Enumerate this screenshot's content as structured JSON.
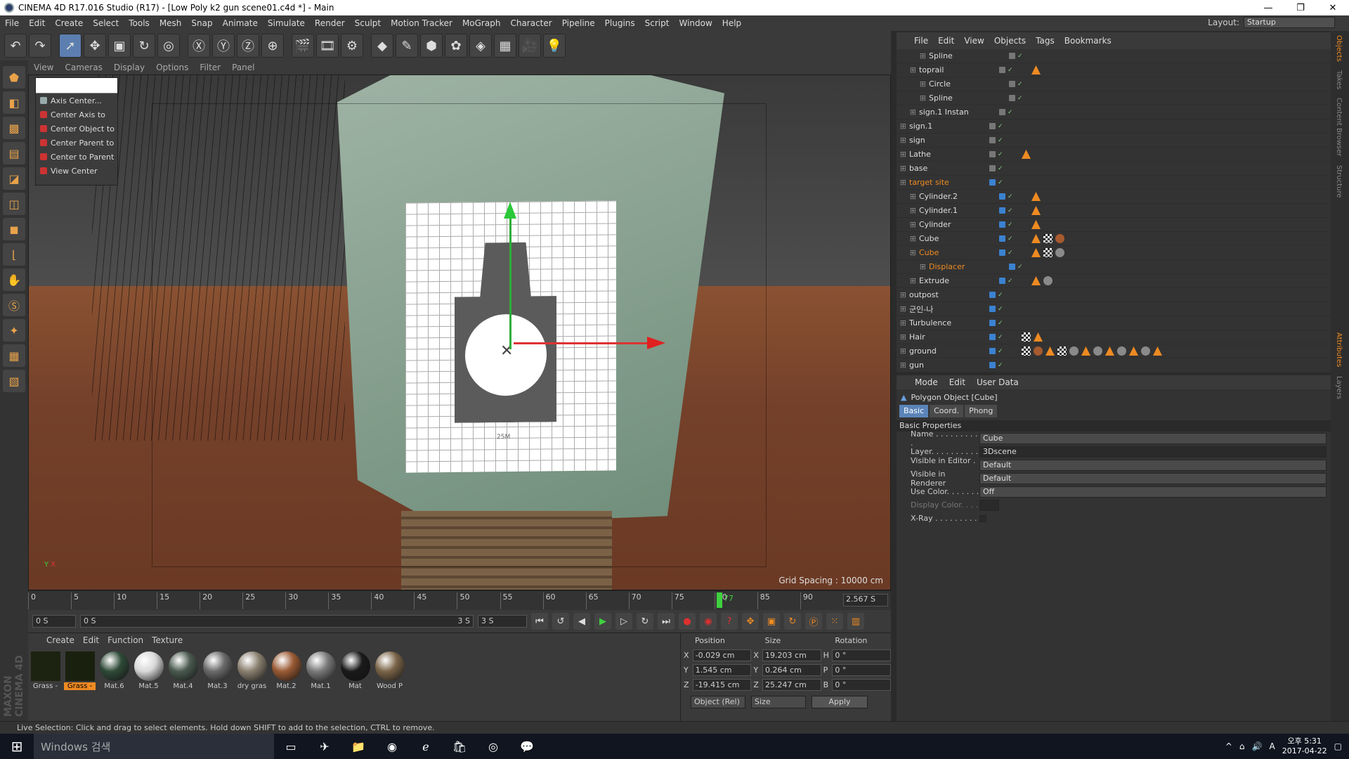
{
  "window": {
    "title": "CINEMA 4D R17.016 Studio (R17) - [Low Poly k2 gun scene01.c4d *] - Main"
  },
  "menubar": {
    "items": [
      "File",
      "Edit",
      "Create",
      "Select",
      "Tools",
      "Mesh",
      "Snap",
      "Animate",
      "Simulate",
      "Render",
      "Sculpt",
      "Motion Tracker",
      "MoGraph",
      "Character",
      "Pipeline",
      "Plugins",
      "Script",
      "Window",
      "Help"
    ],
    "layout_label": "Layout:",
    "layout_value": "Startup"
  },
  "viewport": {
    "menu": [
      "View",
      "Cameras",
      "Display",
      "Options",
      "Filter",
      "Panel"
    ],
    "grid_spacing": "Grid Spacing : 10000 cm",
    "target_label": "25M",
    "axis_y": "Y",
    "axis_x": "X"
  },
  "context_menu": {
    "items": [
      "Axis Center...",
      "Center Axis to",
      "Center Object to",
      "Center Parent to",
      "Center to Parent",
      "View Center"
    ]
  },
  "timeline": {
    "ticks": [
      "0",
      "5",
      "10",
      "15",
      "20",
      "25",
      "30",
      "35",
      "40",
      "45",
      "50",
      "55",
      "60",
      "65",
      "70",
      "75",
      "80",
      "85",
      "90"
    ],
    "current_frame": "77",
    "end_time": "2.567 S"
  },
  "playbar": {
    "start": "0 S",
    "range_start": "0 S",
    "range_end": "3 S",
    "end": "3 S"
  },
  "materials": {
    "menu": [
      "Create",
      "Edit",
      "Function",
      "Texture"
    ],
    "items": [
      {
        "label": "Grass -",
        "swatch": "#1c2310"
      },
      {
        "label": "Grass -",
        "swatch": "#1a200e",
        "selected": true
      },
      {
        "label": "Mat.6",
        "swatch": "#2f4a38"
      },
      {
        "label": "Mat.5",
        "swatch": "#d8d8d8"
      },
      {
        "label": "Mat.4",
        "swatch": "#4a5a50"
      },
      {
        "label": "Mat.3",
        "swatch": "#6a6a6a"
      },
      {
        "label": "dry gras",
        "swatch": "#8a8070"
      },
      {
        "label": "Mat.2",
        "swatch": "#9a5a34"
      },
      {
        "label": "Mat.1",
        "swatch": "#7a7a7a"
      },
      {
        "label": "Mat",
        "swatch": "#1a1a1a"
      },
      {
        "label": "Wood P",
        "swatch": "#7a6448"
      }
    ]
  },
  "coordinates": {
    "headers": [
      "Position",
      "Size",
      "Rotation"
    ],
    "rows": [
      {
        "axis": "X",
        "pos": "-0.029 cm",
        "size_axis": "X",
        "size": "19.203 cm",
        "rot_axis": "H",
        "rot": "0 °"
      },
      {
        "axis": "Y",
        "pos": "1.545 cm",
        "size_axis": "Y",
        "size": "0.264 cm",
        "rot_axis": "P",
        "rot": "0 °"
      },
      {
        "axis": "Z",
        "pos": "-19.415 cm",
        "size_axis": "Z",
        "size": "25.247 cm",
        "rot_axis": "B",
        "rot": "0 °"
      }
    ],
    "mode": "Object (Rel)",
    "size_mode": "Size",
    "apply": "Apply"
  },
  "objects": {
    "menu": [
      "File",
      "Edit",
      "View",
      "Objects",
      "Tags",
      "Bookmarks"
    ],
    "rows": [
      {
        "name": "Spline",
        "indent": 2,
        "highlight": false,
        "tags": []
      },
      {
        "name": "toprail",
        "indent": 1,
        "highlight": false,
        "tags": [
          "org"
        ]
      },
      {
        "name": "Circle",
        "indent": 2,
        "highlight": false,
        "tags": []
      },
      {
        "name": "Spline",
        "indent": 2,
        "highlight": false,
        "tags": []
      },
      {
        "name": "sign.1 Instan",
        "indent": 1,
        "highlight": false,
        "tags": []
      },
      {
        "name": "sign.1",
        "indent": 0,
        "highlight": false,
        "tags": []
      },
      {
        "name": "sign",
        "indent": 0,
        "highlight": false,
        "tags": []
      },
      {
        "name": "Lathe",
        "indent": 0,
        "highlight": false,
        "tags": [
          "org"
        ]
      },
      {
        "name": "base",
        "indent": 0,
        "highlight": false,
        "tags": []
      },
      {
        "name": "target site",
        "indent": 0,
        "highlight": true,
        "tags": []
      },
      {
        "name": "Cylinder.2",
        "indent": 1,
        "highlight": false,
        "tags": [
          "org"
        ]
      },
      {
        "name": "Cylinder.1",
        "indent": 1,
        "highlight": false,
        "tags": [
          "org"
        ]
      },
      {
        "name": "Cylinder",
        "indent": 1,
        "highlight": false,
        "tags": [
          "org"
        ]
      },
      {
        "name": "Cube",
        "indent": 1,
        "highlight": false,
        "tags": [
          "org",
          "chk",
          "brn"
        ]
      },
      {
        "name": "Cube",
        "indent": 1,
        "highlight": true,
        "tags": [
          "org",
          "chk",
          "ball"
        ]
      },
      {
        "name": "Displacer",
        "indent": 2,
        "highlight": true,
        "tags": []
      },
      {
        "name": "Extrude",
        "indent": 1,
        "highlight": false,
        "tags": [
          "org",
          "ball"
        ]
      },
      {
        "name": "outpost",
        "indent": 0,
        "highlight": false,
        "tags": []
      },
      {
        "name": "군인-나",
        "indent": 0,
        "highlight": false,
        "tags": []
      },
      {
        "name": "Turbulence",
        "indent": 0,
        "highlight": false,
        "tags": []
      },
      {
        "name": "Hair",
        "indent": 0,
        "highlight": false,
        "tags": [
          "chk",
          "org"
        ]
      },
      {
        "name": "ground",
        "indent": 0,
        "highlight": false,
        "tags": [
          "chk",
          "brn",
          "org",
          "chk",
          "ball",
          "org",
          "ball",
          "org",
          "ball",
          "org",
          "ball",
          "org"
        ]
      },
      {
        "name": "gun",
        "indent": 0,
        "highlight": false,
        "tags": []
      }
    ]
  },
  "attributes": {
    "menu": [
      "Mode",
      "Edit",
      "User Data"
    ],
    "title": "Polygon Object [Cube]",
    "tabs": [
      "Basic",
      "Coord.",
      "Phong"
    ],
    "section": "Basic Properties",
    "fields": [
      {
        "label": "Name . . . . . . . . . .",
        "value": "Cube"
      },
      {
        "label": "Layer. . . . . . . . . .",
        "value": "3Dscene"
      },
      {
        "label": "Visible in Editor . .",
        "value": "Default"
      },
      {
        "label": "Visible in Renderer",
        "value": "Default"
      },
      {
        "label": "Use Color. . . . . . .",
        "value": "Off"
      },
      {
        "label": "Display Color. . . .",
        "value": ""
      },
      {
        "label": "X-Ray . . . . . . . . .",
        "value": ""
      }
    ]
  },
  "right_strip": [
    "Objects",
    "Takes",
    "Content Browser",
    "Structure",
    "Attributes",
    "Layers"
  ],
  "status": "Live Selection: Click and drag to select elements. Hold down SHIFT to add to the selection, CTRL to remove.",
  "taskbar": {
    "search": "Windows 검색",
    "time": "오후 5:31",
    "date": "2017-04-22",
    "lang": "A"
  },
  "maxon": "MAXON CINEMA 4D"
}
